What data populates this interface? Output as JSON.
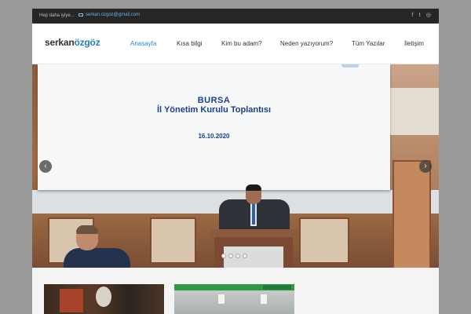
{
  "topbar": {
    "tagline": "Hep daha iyiye...",
    "email": "serkan.ozgoz@gmail.com",
    "social": [
      {
        "icon": "facebook-icon",
        "glyph": "f"
      },
      {
        "icon": "twitter-icon",
        "glyph": "t"
      },
      {
        "icon": "instagram-icon",
        "glyph": "◎"
      }
    ]
  },
  "header": {
    "logo_part1": "serkan",
    "logo_part2": "özgöz",
    "nav": [
      {
        "label": "Anasayfa",
        "active": true
      },
      {
        "label": "Kısa bilgi",
        "active": false
      },
      {
        "label": "Kim bu adam?",
        "active": false
      },
      {
        "label": "Neden yazıyorum?",
        "active": false
      },
      {
        "label": "Tüm Yazılar",
        "active": false
      },
      {
        "label": "İletişim",
        "active": false
      }
    ]
  },
  "slider": {
    "slide_title_line1": "BURSA",
    "slide_title_line2": "İl Yönetim Kurulu Toplantısı",
    "slide_date": "16.10.2020",
    "prev_glyph": "‹",
    "next_glyph": "›",
    "dots": [
      true,
      false,
      false,
      false
    ]
  },
  "colors": {
    "accent": "#1f8ad6",
    "topbar_bg": "#262626",
    "slide_text": "#1a3f8c"
  }
}
